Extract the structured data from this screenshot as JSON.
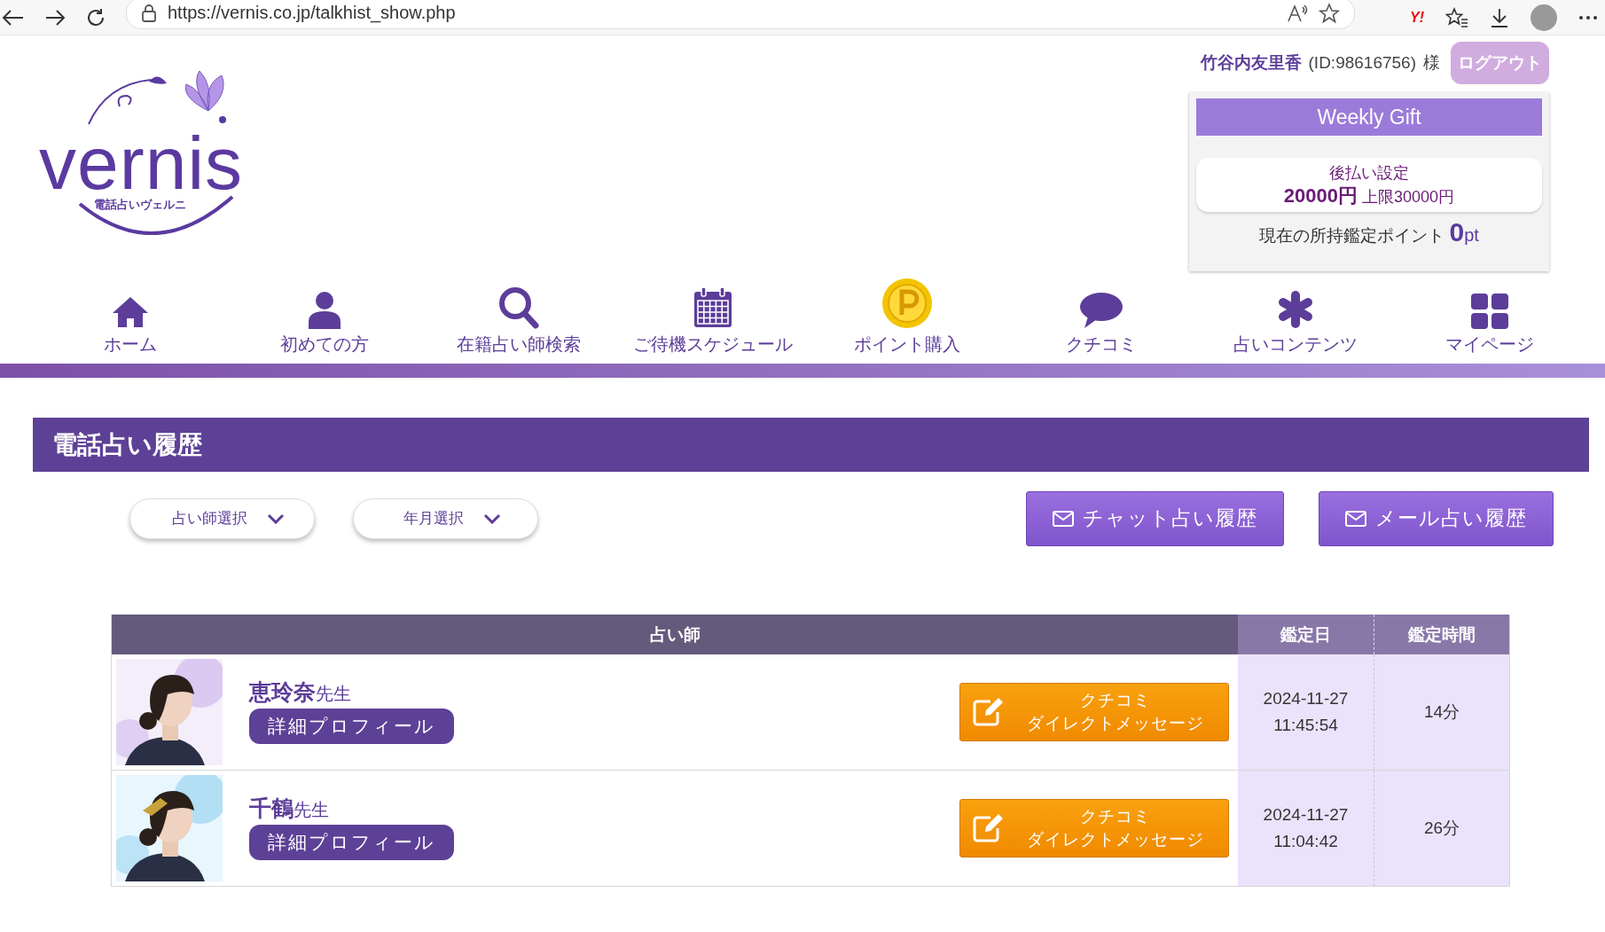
{
  "browser": {
    "url": "https://vernis.co.jp/talkhist_show.php",
    "badge": "Y!"
  },
  "logo": {
    "wordmark": "vernis",
    "tagline": "電話占いヴェルニ"
  },
  "user": {
    "name": "竹谷内友里香",
    "id": "(ID:98616756)",
    "honorific": "様",
    "logout": "ログアウト"
  },
  "gift": {
    "title": "Weekly Gift",
    "deferred_label": "後払い設定",
    "deferred_amount": "20000円",
    "deferred_limit": "上限30000円",
    "points_label": "現在の所持鑑定ポイント",
    "points_value": "0",
    "points_unit": "pt"
  },
  "nav": [
    {
      "label": "ホーム",
      "kind": "home"
    },
    {
      "label": "初めての方",
      "kind": "person"
    },
    {
      "label": "在籍占い師検索",
      "kind": "search"
    },
    {
      "label": "ご待機スケジュール",
      "kind": "calendar"
    },
    {
      "label": "ポイント購入",
      "kind": "coin"
    },
    {
      "label": "クチコミ",
      "kind": "speech"
    },
    {
      "label": "占いコンテンツ",
      "kind": "asterisk"
    },
    {
      "label": "マイページ",
      "kind": "grid"
    }
  ],
  "page_title": "電話占い履歴",
  "filters": [
    {
      "label": "占い師選択"
    },
    {
      "label": "年月選択"
    }
  ],
  "history_links": [
    {
      "label": "チャット占い履歴"
    },
    {
      "label": "メール占い履歴"
    }
  ],
  "table": {
    "columns": [
      "占い師",
      "鑑定日",
      "鑑定時間"
    ],
    "rows": [
      {
        "name": "恵玲奈",
        "suffix": "先生",
        "profile": "詳細プロフィール",
        "review_line1": "クチコミ",
        "review_line2": "ダイレクトメッセージ",
        "date": "2024-11-27",
        "time": "11:45:54",
        "duration": "14分"
      },
      {
        "name": "千鶴",
        "suffix": "先生",
        "profile": "詳細プロフィール",
        "review_line1": "クチコミ",
        "review_line2": "ダイレクトメッセージ",
        "date": "2024-11-27",
        "time": "11:04:42",
        "duration": "26分"
      }
    ]
  }
}
